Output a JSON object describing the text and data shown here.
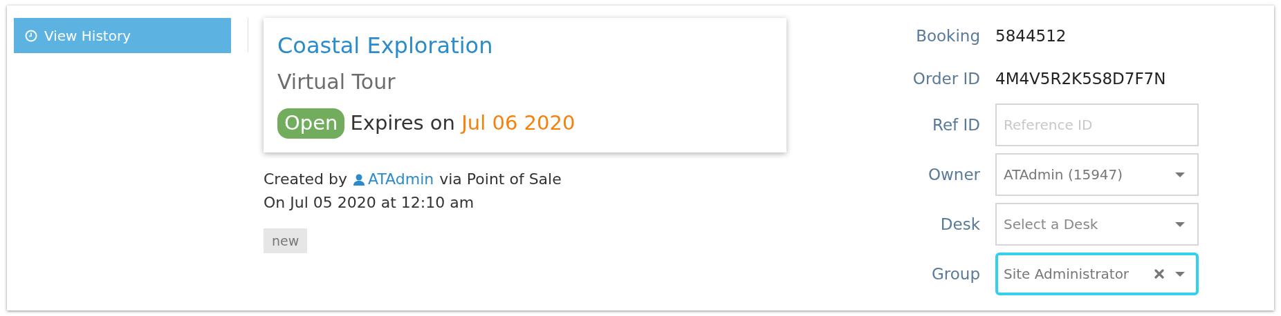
{
  "history_button": {
    "label": "View History"
  },
  "summary": {
    "title": "Coastal Exploration",
    "subtitle": "Virtual Tour",
    "status": "Open",
    "expires_label": "Expires on",
    "expires_date": "Jul 06 2020"
  },
  "created": {
    "prefix": "Created by",
    "user": "ATAdmin",
    "suffix": "via Point of Sale",
    "date_line": "On Jul 05 2020 at 12:10 am"
  },
  "tags": [
    "new"
  ],
  "fields": [
    {
      "label": "Booking",
      "kind": "text",
      "value": "5844512"
    },
    {
      "label": "Order ID",
      "kind": "text",
      "value": "4M4V5R2K5S8D7F7N"
    },
    {
      "label": "Ref ID",
      "kind": "input",
      "placeholder": "Reference ID",
      "focused": false
    },
    {
      "label": "Owner",
      "kind": "select",
      "value": "ATAdmin (15947)",
      "clearable": false,
      "focused": false
    },
    {
      "label": "Desk",
      "kind": "select",
      "placeholder": "Select a Desk",
      "clearable": false,
      "focused": false
    },
    {
      "label": "Group",
      "kind": "select",
      "value": "Site Administrator",
      "clearable": true,
      "focused": true
    }
  ]
}
